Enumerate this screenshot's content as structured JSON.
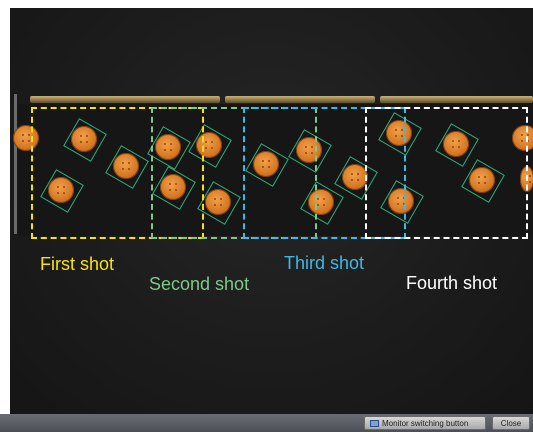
{
  "labels": {
    "first_shot": "First shot",
    "second_shot": "Second shot",
    "third_shot": "Third shot",
    "fourth_shot": "Fourth shot"
  },
  "colors": {
    "first": "#f5e11a",
    "second": "#7cc98a",
    "third": "#3fb8e6",
    "fourth": "#ffffff"
  },
  "toolbar": {
    "monitor_switch_label": "Monitor switching button",
    "monitor_switch_icon": "monitor-icon",
    "close_label": "Close"
  }
}
